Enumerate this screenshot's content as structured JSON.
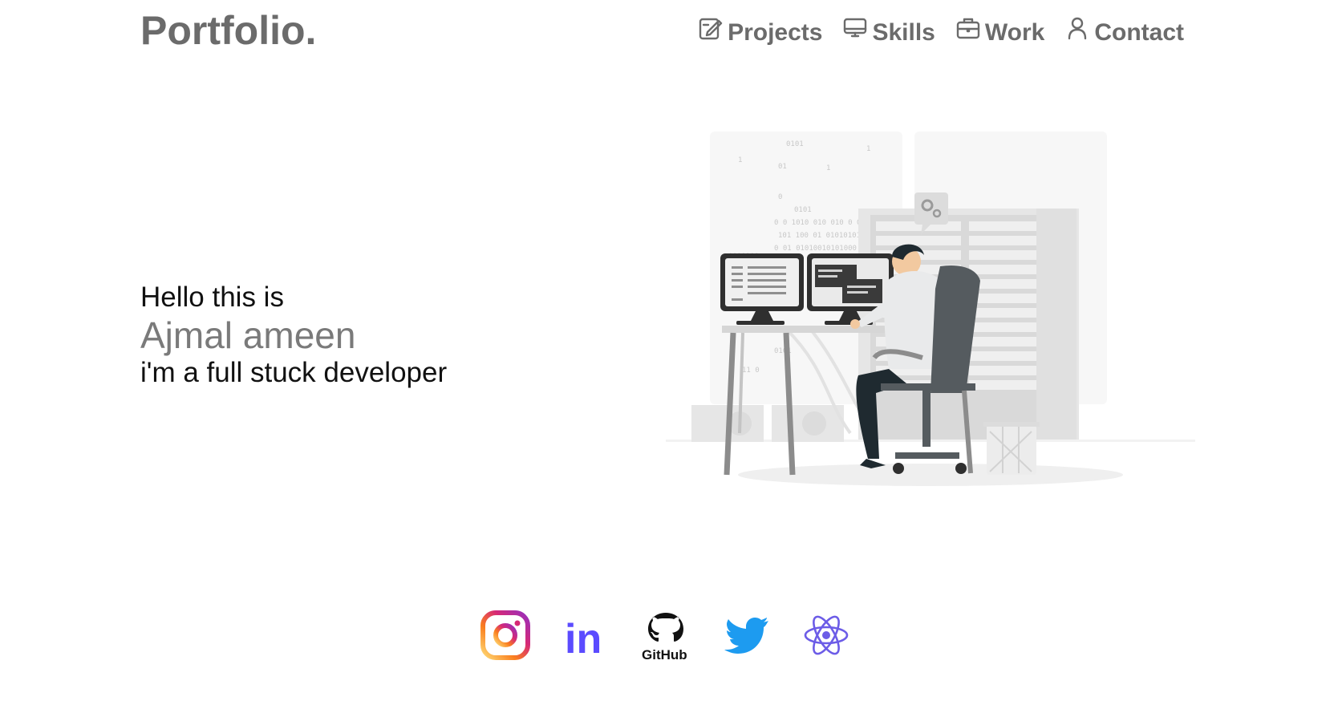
{
  "header": {
    "logo": "Portfolio.",
    "nav": [
      {
        "label": "Projects",
        "icon": "edit-icon"
      },
      {
        "label": "Skills",
        "icon": "monitor-icon"
      },
      {
        "label": "Work",
        "icon": "briefcase-icon"
      },
      {
        "label": "Contact",
        "icon": "user-icon"
      }
    ]
  },
  "hero": {
    "greeting": "Hello this is",
    "name": "Ajmal ameen",
    "tagline": "i'm a full stuck developer"
  },
  "social": [
    {
      "name": "instagram-icon"
    },
    {
      "name": "linkedin-icon",
      "text": "in"
    },
    {
      "name": "github-icon",
      "text": "GitHub"
    },
    {
      "name": "twitter-icon"
    },
    {
      "name": "react-icon"
    }
  ],
  "colors": {
    "primary_gray": "#6b6b6b",
    "name_gray": "#7a7a7a",
    "text_dark": "#111111",
    "linkedin": "#5b4bff",
    "twitter": "#1d9bf0",
    "react": "#6c5ce7"
  }
}
